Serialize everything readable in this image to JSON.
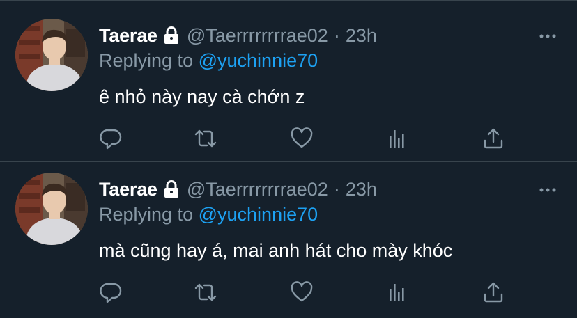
{
  "tweets": [
    {
      "display_name": "Taerae",
      "handle": "@Taerrrrrrrrae02",
      "separator": "·",
      "time": "23h",
      "replying_prefix": "Replying to",
      "replying_to": "@yuchinnie70",
      "text": "ê nhỏ này nay cà chớn z",
      "protected": true
    },
    {
      "display_name": "Taerae",
      "handle": "@Taerrrrrrrrae02",
      "separator": "·",
      "time": "23h",
      "replying_prefix": "Replying to",
      "replying_to": "@yuchinnie70",
      "text": "mà cũng hay á, mai anh hát cho mày khóc",
      "protected": true
    }
  ],
  "icons": {
    "lock": "lock-icon",
    "more": "more-icon",
    "reply": "reply-icon",
    "retweet": "retweet-icon",
    "like": "heart-icon",
    "analytics": "analytics-icon",
    "share": "share-icon"
  },
  "colors": {
    "background": "#15202b",
    "text_primary": "#ffffff",
    "text_secondary": "#8899a6",
    "accent": "#1da1f2",
    "divider": "#38444d"
  }
}
